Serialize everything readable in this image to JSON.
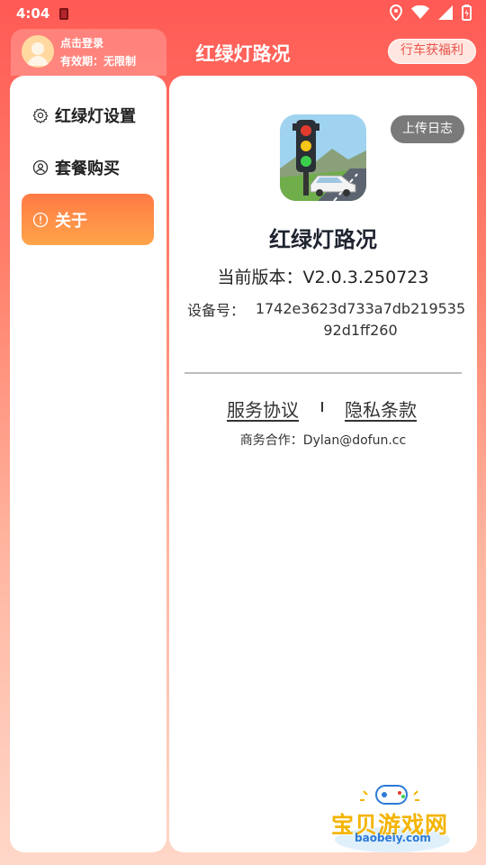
{
  "status_bar": {
    "time": "4:04"
  },
  "header": {
    "login": "点击登录",
    "validity": "有效期：无限制",
    "title": "红绿灯路况",
    "rewards_button": "行车获福利"
  },
  "sidebar": {
    "items": [
      {
        "label": "红绿灯设置",
        "icon": "gear-icon",
        "active": false
      },
      {
        "label": "套餐购买",
        "icon": "user-circle-icon",
        "active": false
      },
      {
        "label": "关于",
        "icon": "info-circle-icon",
        "active": true
      }
    ]
  },
  "about": {
    "upload_log": "上传日志",
    "app_name": "红绿灯路况",
    "version": "当前版本：V2.0.3.250723",
    "device_label": "设备号：",
    "device_id": "1742e3623d733a7db21953592d1ff260",
    "service_agreement": "服务协议",
    "privacy_policy": "隐私条款",
    "business": "商务合作：Dylan@dofun.cc"
  },
  "watermark": {
    "name": "宝贝游戏网",
    "url": "baobeiy.com"
  },
  "colors": {
    "header_gradient_top": "#ff5a55",
    "active_item": "#ff8a48",
    "rewards_text": "#e8564b",
    "upload_log_bg": "#7a7a7a"
  }
}
